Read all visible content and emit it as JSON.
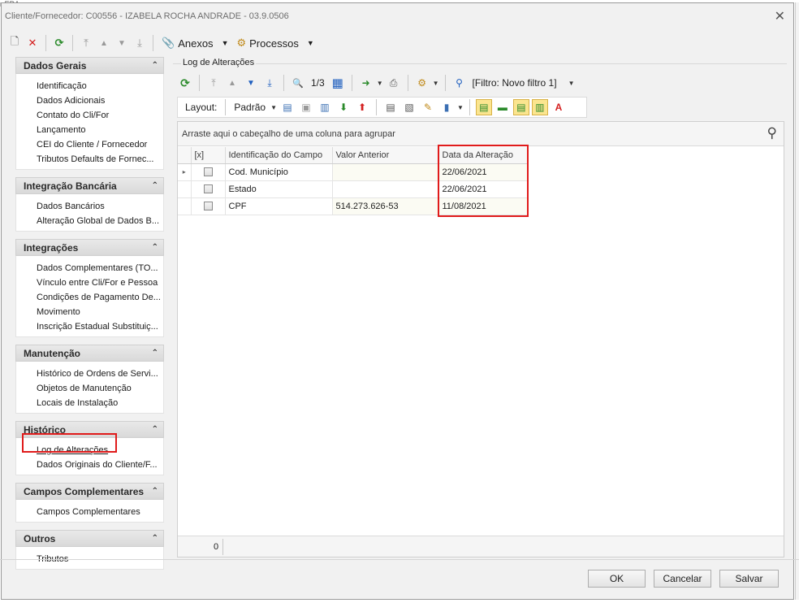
{
  "ghost_title": "r ERA...",
  "window": {
    "title": "Cliente/Fornecedor: C00556 - IZABELA ROCHA ANDRADE - 03.9.0506",
    "close_glyph": "✕"
  },
  "toolbar": {
    "new_glyph": "🗋",
    "delete_glyph": "✕",
    "refresh_glyph": "⟳",
    "first_glyph": "⤒",
    "prev_glyph": "▲",
    "next_glyph": "▼",
    "last_glyph": "⤓",
    "attachments_glyph": "📎",
    "attachments_label": "Anexos",
    "processes_glyph": "⚙",
    "processes_label": "Processos",
    "caret": "▼"
  },
  "sidebar": {
    "collapse_glyph": "⌃",
    "groups": [
      {
        "title": "Dados Gerais",
        "items": [
          "Identificação",
          "Dados Adicionais",
          "Contato do Cli/For",
          "Lançamento",
          "CEI do Cliente / Fornecedor",
          "Tributos Defaults de Fornec..."
        ]
      },
      {
        "title": "Integração Bancária",
        "items": [
          "Dados Bancários",
          "Alteração Global de Dados B..."
        ]
      },
      {
        "title": "Integrações",
        "items": [
          "Dados Complementares (TO...",
          "Vínculo entre Cli/For e Pessoa",
          "Condições de Pagamento De...",
          "Movimento",
          "Inscrição Estadual Substituiç..."
        ]
      },
      {
        "title": "Manutenção",
        "items": [
          "Histórico de Ordens de Servi...",
          "Objetos de Manutenção",
          "Locais de Instalação"
        ]
      },
      {
        "title": "Histórico",
        "items": [
          "Log de Alterações",
          "Dados Originais do Cliente/F..."
        ]
      },
      {
        "title": "Campos Complementares",
        "items": [
          "Campos Complementares"
        ]
      },
      {
        "title": "Outros",
        "items": [
          "Tributos"
        ]
      }
    ]
  },
  "panel": {
    "title": "Log de Alterações",
    "nav": {
      "refresh_glyph": "⟳",
      "first_glyph": "⤒",
      "prev_glyph": "▲",
      "next_glyph": "▼",
      "last_glyph": "⤓",
      "find_glyph": "🔍",
      "record_indicator": "1/3",
      "calendar_glyph": "▦",
      "export_glyph": "➜",
      "print_glyph": "⎙",
      "process_glyph": "⚙",
      "filter_glyph": "⚲",
      "filter_label": "[Filtro: Novo filtro 1]"
    },
    "layout_bar": {
      "layout_label": "Layout:",
      "preset_label": "Padrão",
      "view_glyphs": [
        "▤",
        "▣",
        "▥",
        "⬇",
        "⬆",
        "▤",
        "▧",
        "✎"
      ],
      "chart_glyph": "▮",
      "toggle_glyphs": [
        "▤",
        "▬",
        "▤",
        "▥",
        "A"
      ]
    },
    "grid": {
      "group_hint": "Arraste aqui o cabeçalho de uma coluna para agrupar",
      "search_glyph": "⚲",
      "row_indicator_glyph": "▸",
      "columns": [
        "[x]",
        "Identificação do Campo",
        "Valor Anterior",
        "Data da Alteração"
      ],
      "rows": [
        {
          "field": "Cod. Município",
          "previous": "",
          "date": "22/06/2021"
        },
        {
          "field": "Estado",
          "previous": "",
          "date": "22/06/2021"
        },
        {
          "field": "CPF",
          "previous": "514.273.626-53",
          "date": "11/08/2021"
        }
      ],
      "footer_count": "0"
    }
  },
  "buttons": {
    "ok": "OK",
    "cancel": "Cancelar",
    "save": "Salvar"
  },
  "colors": {
    "highlight_box": "#e01b1b",
    "refresh_green": "#2a8a2a",
    "delete_red": "#d42020",
    "nav_blue": "#1f5fbf"
  }
}
